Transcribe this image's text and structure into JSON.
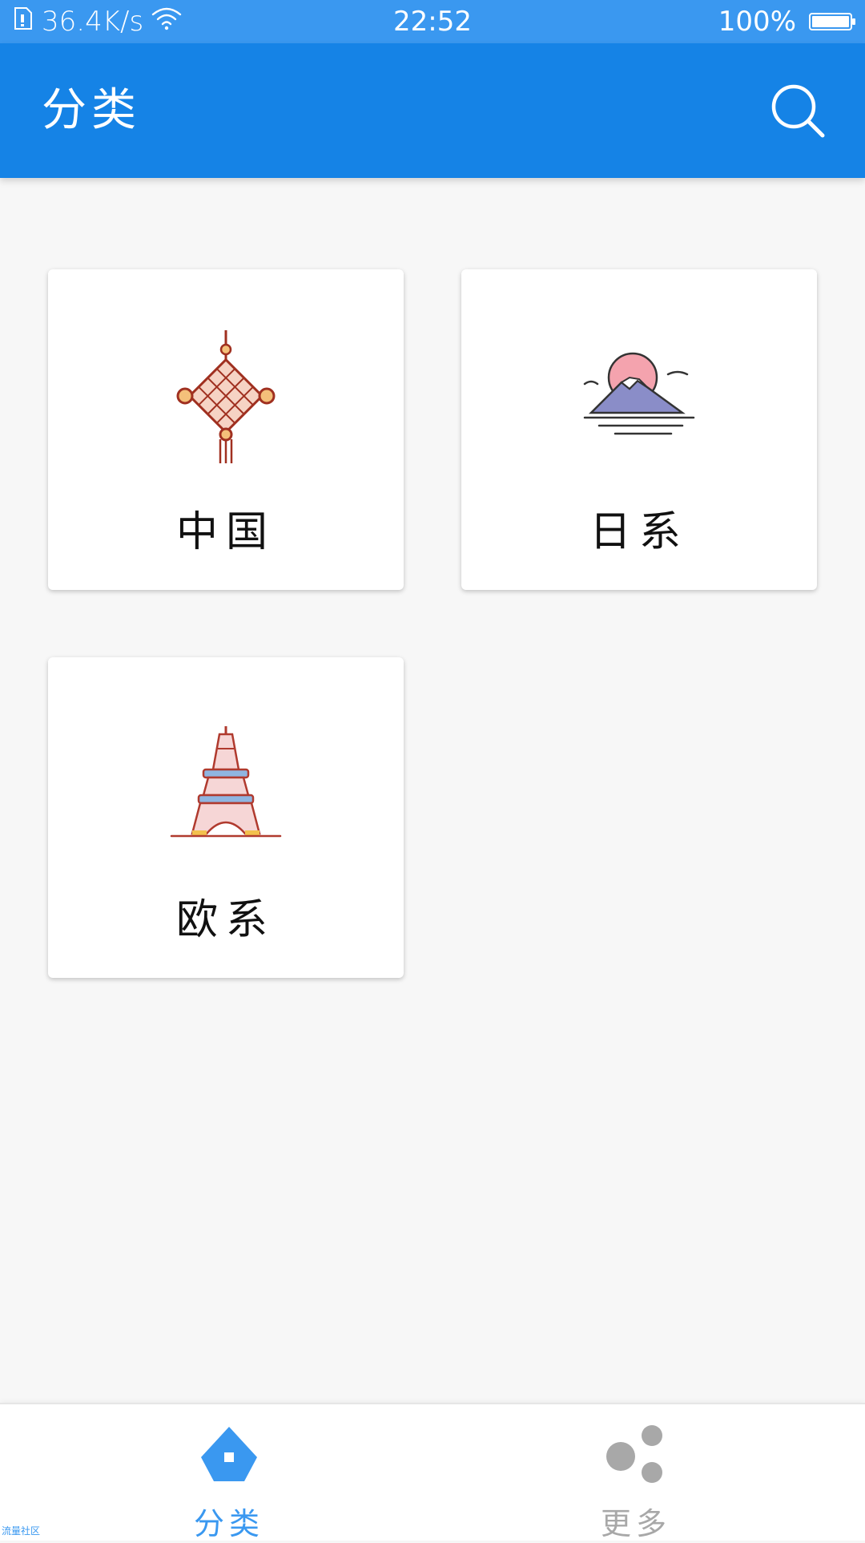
{
  "status_bar": {
    "net_speed": "36.4K/s",
    "time": "22:52",
    "battery": "100%",
    "battery_level": 1.0
  },
  "app_bar": {
    "title": "分类",
    "search_icon": "search-icon"
  },
  "categories": [
    {
      "label": "中国",
      "icon": "chinese-knot-icon"
    },
    {
      "label": "日系",
      "icon": "mount-fuji-icon"
    },
    {
      "label": "欧系",
      "icon": "eiffel-tower-icon"
    }
  ],
  "bottom_nav": {
    "items": [
      {
        "label": "分类",
        "icon": "category-icon",
        "active": true
      },
      {
        "label": "更多",
        "icon": "more-dots-icon",
        "active": false
      }
    ],
    "active_color": "#3a98f0",
    "inactive_color": "#a8a8a8"
  },
  "watermark": "流量社区",
  "colors": {
    "status_bar": "#3a98f0",
    "app_bar": "#1583e6",
    "background": "#f7f7f7"
  }
}
